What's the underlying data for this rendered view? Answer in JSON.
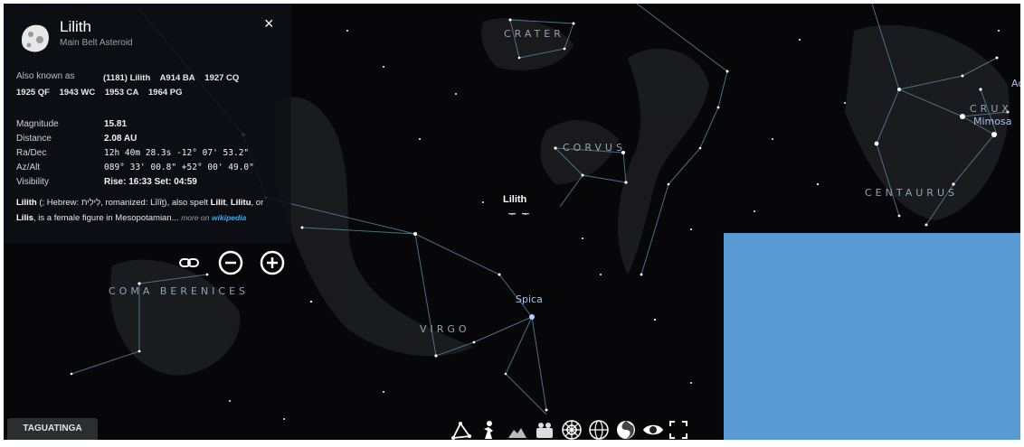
{
  "object": {
    "name": "Lilith",
    "type": "Main Belt Asteroid",
    "aka_label": "Also known as",
    "aka": [
      "(1181) Lilith",
      "A914 BA",
      "1927 CQ",
      "1925 QF",
      "1943 WC",
      "1953 CA",
      "1964 PG"
    ],
    "fields": [
      {
        "label": "Magnitude",
        "value": "15.81"
      },
      {
        "label": "Distance",
        "value": "2.08 AU"
      },
      {
        "label": "Ra/Dec",
        "value": "12h 40m 28.3s   -12° 07' 53.2\""
      },
      {
        "label": "Az/Alt",
        "value": "089° 33' 00.8\"   +52° 00' 49.0\""
      },
      {
        "label": "Visibility",
        "value": "Rise: 16:33   Set: 04:59"
      }
    ],
    "desc_bold": "Lilith",
    "desc_text": " (; Hebrew: לִילִית, romanized: Līlīṯ), also spelt ",
    "desc_alt1": "Lilit",
    "desc_sep": ", ",
    "desc_alt2": "Lilitu",
    "desc_or": ", or ",
    "desc_alt3": "Lilis",
    "desc_end": ", is a female figure in Mesopotamian...",
    "more_on": "more on",
    "wikipedia": "wikipedia",
    "close_icon": "×"
  },
  "constellations": [
    "CRATER",
    "CORVUS",
    "CRUX",
    "CENTAURUS",
    "COMA BERENICES",
    "VIRGO"
  ],
  "stars": [
    "Spica",
    "Mimosa",
    "Ac"
  ],
  "target": {
    "label": "Lilith",
    "mark": "ᅮ ᅮ"
  },
  "location": "TAGUATINGA",
  "toolbar": [
    "constellation-lines-icon",
    "constellation-art-icon",
    "landscape-icon",
    "atmosphere-icon",
    "azimuthal-grid-icon",
    "equatorial-grid-icon",
    "deep-sky-icon",
    "night-mode-icon",
    "fullscreen-icon"
  ],
  "colors": {
    "panel": "#0f1014",
    "overlay": "#5b9bd5",
    "link": "#3aa8e8",
    "lines": "#4f7d8c"
  }
}
